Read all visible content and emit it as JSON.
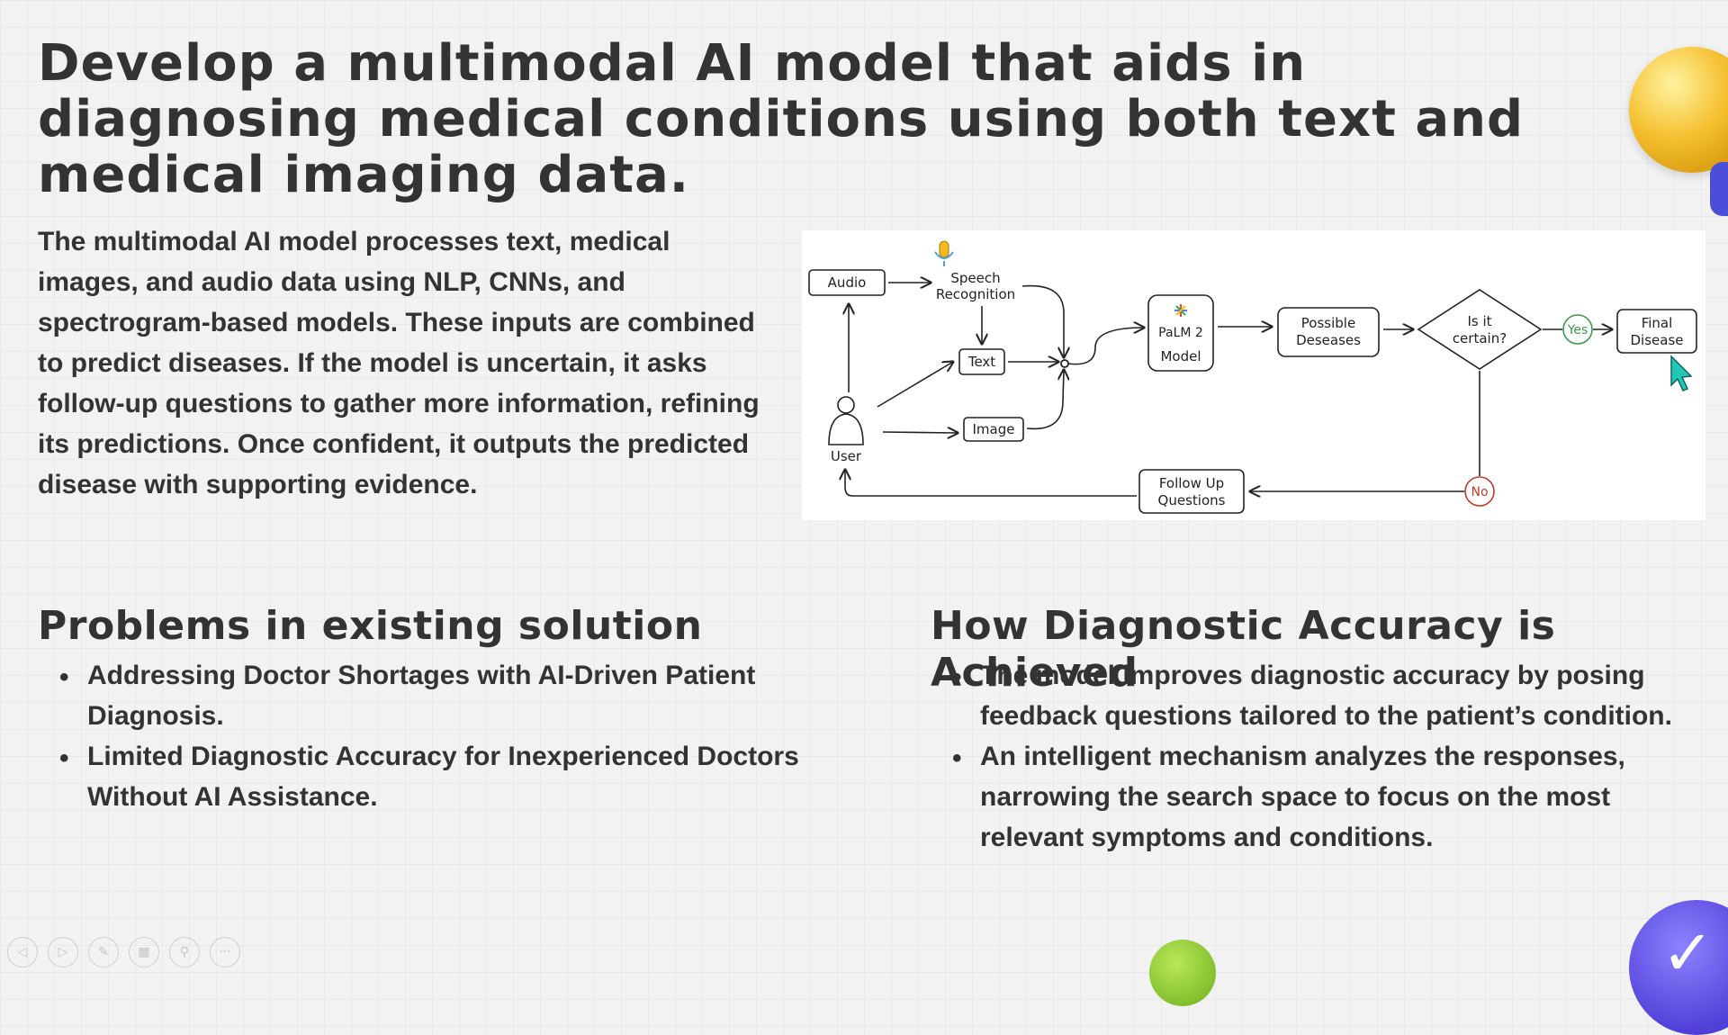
{
  "title": "Develop a multimodal AI model that aids in diagnosing medical conditions using both text and medical imaging data.",
  "intro": "The multimodal AI model processes text, medical images, and audio data using NLP, CNNs, and spectrogram-based models. These inputs are combined to predict diseases. If the model is uncertain, it asks follow-up questions to gather more information, refining its predictions. Once confident, it outputs the predicted disease with supporting evidence.",
  "diagram": {
    "audio": "Audio",
    "speech_line1": "Speech",
    "speech_line2": "Recognition",
    "text": "Text",
    "image": "Image",
    "user": "User",
    "palm_line1": "PaLM 2",
    "palm_line2": "Model",
    "possible_line1": "Possible",
    "possible_line2": "Deseases",
    "decision_line1": "Is it",
    "decision_line2": "certain?",
    "yes": "Yes",
    "no": "No",
    "final_line1": "Final",
    "final_line2": "Disease",
    "followup_line1": "Follow Up",
    "followup_line2": "Questions"
  },
  "problems": {
    "heading": "Problems in existing solution",
    "items": [
      "Addressing Doctor Shortages with AI-Driven Patient Diagnosis.",
      "Limited Diagnostic Accuracy for Inexperienced Doctors Without AI Assistance."
    ]
  },
  "accuracy": {
    "heading": "How Diagnostic Accuracy is Achieved",
    "items": [
      "The model improves diagnostic accuracy by posing feedback questions tailored to the patient’s condition.",
      "An intelligent mechanism analyzes the responses, narrowing the search space to focus on the most relevant symptoms and conditions."
    ]
  },
  "icons": {
    "controls": [
      "previous-icon",
      "next-icon",
      "pen-icon",
      "slides-icon",
      "zoom-icon",
      "more-icon"
    ],
    "decorations": [
      "lightbulb-icon",
      "checkmark-badge-icon",
      "microphone-icon",
      "palm-logo-icon",
      "cursor-icon"
    ]
  },
  "colors": {
    "yes": "#3a9a4a",
    "no": "#c0392b",
    "cursor": "#22c7b8",
    "bulb": "#f5c030",
    "badge": "#5140d8"
  }
}
